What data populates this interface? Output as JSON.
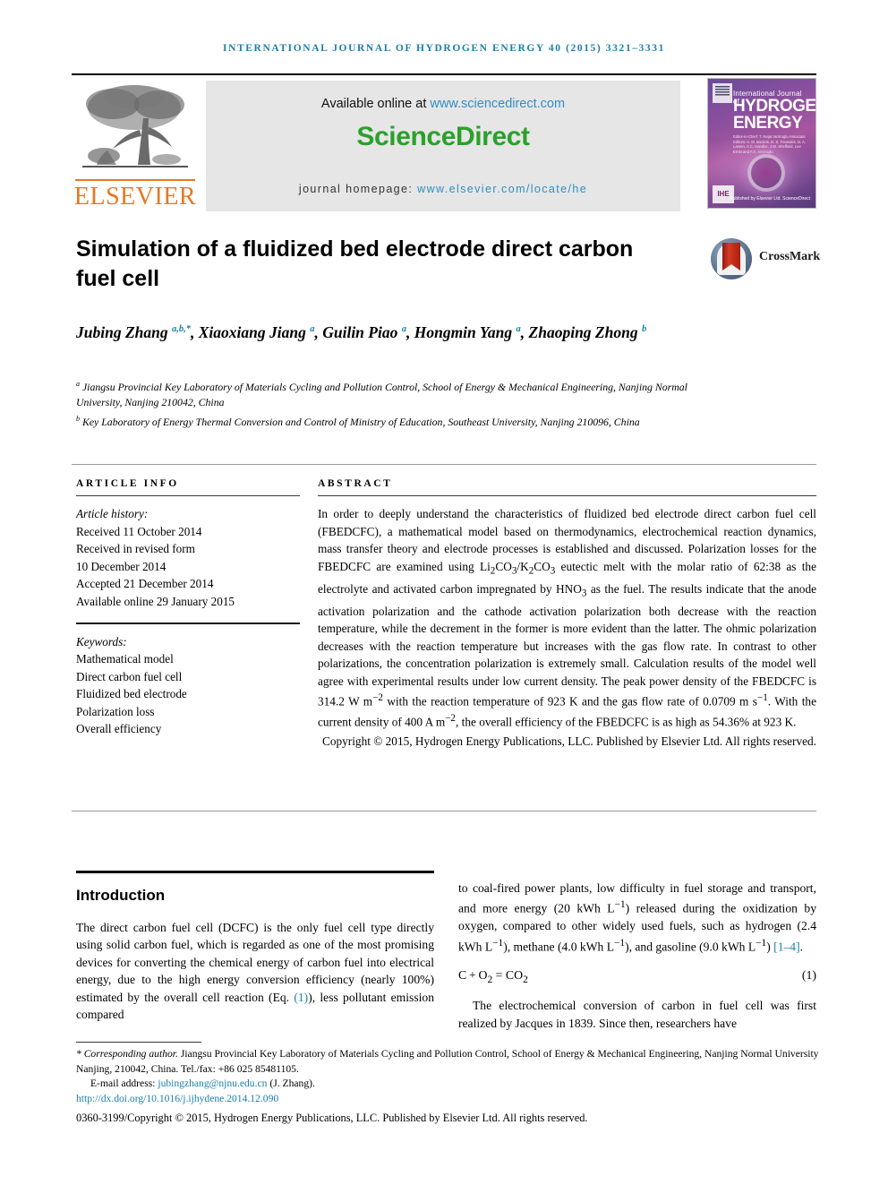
{
  "running_head": "International Journal of Hydrogen Energy 40 (2015) 3321–3331",
  "masthead": {
    "publisher_name": "ELSEVIER",
    "available_text": "Available online at ",
    "available_url": "www.sciencedirect.com",
    "sciencedirect_logo": "ScienceDirect",
    "homepage_label": "journal homepage: ",
    "homepage_url": "www.elsevier.com/locate/he",
    "cover": {
      "line1": "International Journal of",
      "line2": "HYDROGEN",
      "line3": "ENERGY",
      "editors": "Editor-in-Chief: T. Nejat Veziroglu    Associate Editors: A. M. Bockris, D. S. Founakis, N. A. Larsen, A.C. Handke, J.W. Sheffield, Lee Ernst and F.A. Aminoglu",
      "ihe_mark": "IHE",
      "sd_mark": "Published by Elsevier Ltd.  ScienceDirect"
    }
  },
  "article": {
    "title": "Simulation of a fluidized bed electrode direct carbon fuel cell",
    "crossmark_label": "CrossMark",
    "authors_html": "Jubing Zhang <sup>a,b,*</sup>, Xiaoxiang Jiang <sup>a</sup>, Guilin Piao <sup>a</sup>, Hongmin Yang <sup>a</sup>, Zhaoping Zhong <sup>b</sup>",
    "affiliation_a": "<sup>a</sup> Jiangsu Provincial Key Laboratory of Materials Cycling and Pollution Control, School of Energy &amp; Mechanical Engineering, Nanjing Normal University, Nanjing 210042, China",
    "affiliation_b": "<sup>b</sup> Key Laboratory of Energy Thermal Conversion and Control of Ministry of Education, Southeast University, Nanjing 210096, China"
  },
  "info": {
    "heading": "Article info",
    "history_label": "Article history:",
    "history": [
      "Received 11 October 2014",
      "Received in revised form",
      "10 December 2014",
      "Accepted 21 December 2014",
      "Available online 29 January 2015"
    ],
    "keywords_label": "Keywords:",
    "keywords": [
      "Mathematical model",
      "Direct carbon fuel cell",
      "Fluidized bed electrode",
      "Polarization loss",
      "Overall efficiency"
    ]
  },
  "abstract": {
    "heading": "Abstract",
    "body_html": "In order to deeply understand the characteristics of fluidized bed electrode direct carbon fuel cell (FBEDCFC), a mathematical model based on thermodynamics, electrochemical reaction dynamics, mass transfer theory and electrode processes is established and discussed. Polarization losses for the FBEDCFC are examined using Li<sub>2</sub>CO<sub>3</sub>/K<sub>2</sub>CO<sub>3</sub> eutectic melt with the molar ratio of 62:38 as the electrolyte and activated carbon impregnated by HNO<sub>3</sub> as the fuel. The results indicate that the anode activation polarization and the cathode activation polarization both decrease with the reaction temperature, while the decrement in the former is more evident than the latter. The ohmic polarization decreases with the reaction temperature but increases with the gas flow rate. In contrast to other polarizations, the concentration polarization is extremely small. Calculation results of the model well agree with experimental results under low current density. The peak power density of the FBEDCFC is 314.2 W m<sup>−2</sup> with the reaction temperature of 923 K and the gas flow rate of 0.0709 m s<sup>−1</sup>. With the current density of 400 A m<sup>−2</sup>, the overall efficiency of the FBEDCFC is as high as 54.36% at 923 K.",
    "copyright": "Copyright © 2015, Hydrogen Energy Publications, LLC. Published by Elsevier Ltd. All rights reserved."
  },
  "body": {
    "intro_heading": "Introduction",
    "left_para_html": "The direct carbon fuel cell (DCFC) is the only fuel cell type directly using solid carbon fuel, which is regarded as one of the most promising devices for converting the chemical energy of carbon fuel into electrical energy, due to the high energy conversion efficiency (nearly 100%) estimated by the overall cell reaction (Eq. <span class=\"lnk\">(1)</span>), less pollutant emission compared",
    "right_para_html": "to coal-fired power plants, low difficulty in fuel storage and transport, and more energy (20 kWh L<sup>−1</sup>) released during the oxidization by oxygen, compared to other widely used fuels, such as hydrogen (2.4 kWh L<sup>−1</sup>), methane (4.0 kWh L<sup>−1</sup>), and gasoline (9.0 kWh L<sup>−1</sup>) <span class=\"lnk\">[1–4]</span>.",
    "equation_html": "C&thinsp;+&thinsp;O<sub>2</sub> = CO<sub>2</sub>",
    "equation_number": "(1)",
    "right_para2_html": "The electrochemical conversion of carbon in fuel cell was first realized by Jacques in 1839. Since then, researchers have"
  },
  "footer": {
    "corresponding_html": "<span class=\"corr\">* Corresponding author.</span> Jiangsu Provincial Key Laboratory of Materials Cycling and Pollution Control, School of Energy &amp; Mechanical Engineering, Nanjing Normal University Nanjing, 210042, China. Tel./fax: +86 025 85481105.",
    "email_label": "E-mail address: ",
    "email": "jubingzhang@njnu.edu.cn",
    "email_suffix": " (J. Zhang).",
    "doi": "http://dx.doi.org/10.1016/j.ijhydene.2014.12.090",
    "issn_line": "0360-3199/Copyright © 2015, Hydrogen Energy Publications, LLC. Published by Elsevier Ltd. All rights reserved."
  },
  "colors": {
    "link_blue": "#1d7fa8",
    "elsevier_orange": "#E87722",
    "sciencedirect_green": "#2ba02b",
    "band_gray": "#e6e6e6"
  }
}
